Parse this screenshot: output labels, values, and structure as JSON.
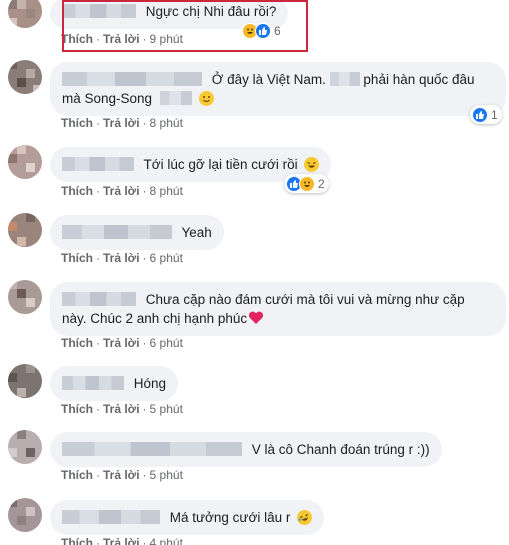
{
  "common": {
    "like_label": "Thích",
    "reply_label": "Trả lời",
    "separator": "·"
  },
  "comments": [
    {
      "text": "Ngực chị Nhi đâu rồi?",
      "time": "9 phút",
      "reaction_count": "6",
      "reactions": [
        "haha-icon",
        "like-icon"
      ]
    },
    {
      "text_a": "Ở đây là Việt Nam.",
      "text_b": "phải hàn quốc đâu",
      "text_c": "mà Song-Song",
      "time": "8 phút",
      "reaction_count": "1",
      "reactions": [
        "like-icon"
      ]
    },
    {
      "text": "Tới lúc gỡ lại tiền cưới rồi",
      "time": "8 phút",
      "reaction_count": "2",
      "reactions": [
        "like-icon",
        "haha-icon"
      ]
    },
    {
      "text": "Yeah",
      "time": "6 phút"
    },
    {
      "text_a": "Chưa cặp nào đám cưới mà tôi vui và mừng như cặp",
      "text_b": "này. Chúc 2 anh chị hạnh phúc",
      "time": "6 phút"
    },
    {
      "text": "Hóng",
      "time": "5 phút"
    },
    {
      "text": "V là cô Chanh đoán trúng r :))",
      "time": "5 phút"
    },
    {
      "text": "Má tưởng cưới lâu r",
      "time": "4 phút"
    }
  ],
  "colors": {
    "bubble": "#f0f2f5",
    "meta": "#65676b",
    "like_blue": "#1877f2",
    "haha_yellow": "#f7b928",
    "highlight_red": "#c9283e",
    "heart_red": "#e0245e"
  }
}
